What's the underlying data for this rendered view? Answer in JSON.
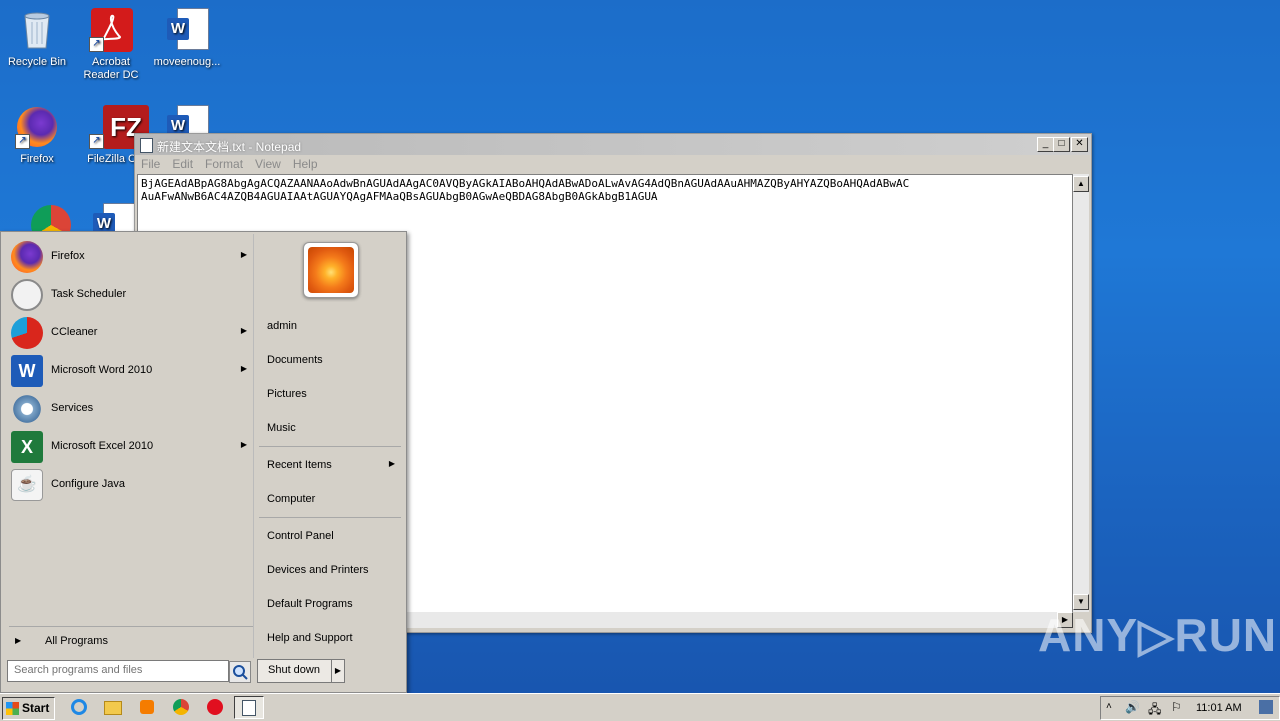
{
  "desktop": {
    "icons": [
      {
        "label": "Recycle Bin",
        "icon": "recycle-bin-icon"
      },
      {
        "label": "Acrobat\nReader DC",
        "icon": "acrobat-icon"
      },
      {
        "label": "moveenoug...",
        "icon": "word-document-icon"
      },
      {
        "label": "Firefox",
        "icon": "firefox-icon"
      },
      {
        "label": "FileZilla Cli",
        "icon": "filezilla-icon"
      },
      {
        "label": "",
        "icon": "word-document-icon"
      },
      {
        "label": "",
        "icon": "chrome-icon"
      },
      {
        "label": "",
        "icon": "word-document-icon"
      }
    ]
  },
  "notepad": {
    "title": "新建文本文档.txt - Notepad",
    "menu": [
      "File",
      "Edit",
      "Format",
      "View",
      "Help"
    ],
    "content_line1": "BjAGEAdABpAG8AbgAgACQAZAANAAoAdwBnAGUAdAAgAC0AVQByAGkAIABoAHQAdABwADoALwAvAG4AdQBnAGUAdAAuAHMAZQByAHYAZQBoAHQAdABwAC",
    "content_line2": "AuAFwANwB6AC4AZQB4AGUAIAAtAGUAYQAgAFMAaQBsAGUAbgB0AGwAeQBDAG8AbgB0AGkAbgB1AGUA"
  },
  "start_menu": {
    "programs": [
      {
        "label": "Firefox",
        "icon": "firefox-icon",
        "submenu": true
      },
      {
        "label": "Task Scheduler",
        "icon": "clock-icon",
        "submenu": false
      },
      {
        "label": "CCleaner",
        "icon": "ccleaner-icon",
        "submenu": true
      },
      {
        "label": "Microsoft Word 2010",
        "icon": "word-icon",
        "submenu": true
      },
      {
        "label": "Services",
        "icon": "gears-icon",
        "submenu": false
      },
      {
        "label": "Microsoft Excel 2010",
        "icon": "excel-icon",
        "submenu": true
      },
      {
        "label": "Configure Java",
        "icon": "java-icon",
        "submenu": false
      }
    ],
    "all_programs": "All Programs",
    "search_placeholder": "Search programs and files",
    "right_items": [
      "admin",
      "Documents",
      "Pictures",
      "Music",
      "Recent Items",
      "Computer",
      "Control Panel",
      "Devices and Printers",
      "Default Programs",
      "Help and Support"
    ],
    "shutdown": "Shut down"
  },
  "taskbar": {
    "start_label": "Start",
    "clock": "11:01 AM",
    "pinned": [
      "internet-explorer-icon",
      "explorer-folder-icon",
      "media-player-icon",
      "chrome-icon",
      "opera-icon",
      "notepad-icon"
    ]
  },
  "watermark": "ANY▷RUN"
}
